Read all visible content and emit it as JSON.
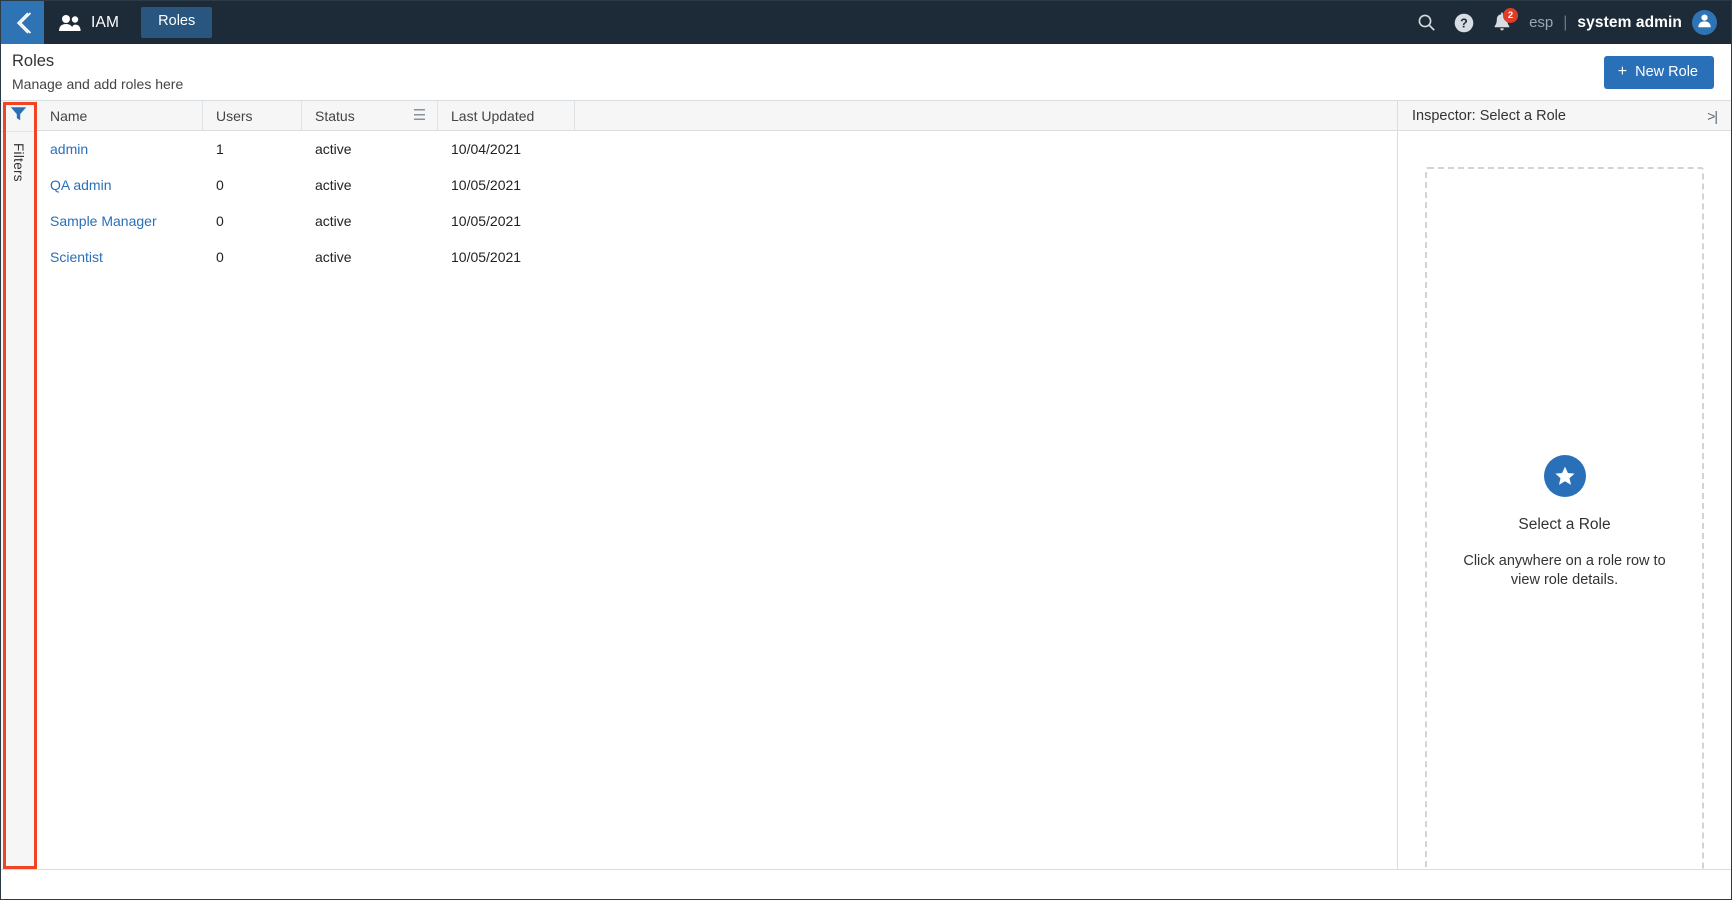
{
  "topnav": {
    "back_icon": "chevron-left-icon",
    "app_icon": "people-icon",
    "app_label": "IAM",
    "tab_label": "Roles",
    "search_icon": "search-icon",
    "help_icon": "help-circle-icon",
    "bell_icon": "bell-icon",
    "notification_count": "2",
    "language": "esp",
    "separator": "|",
    "user_name": "system admin",
    "avatar_icon": "user-avatar-icon",
    "accent_blue": "#2e74b5",
    "nav_background": "#1d2b38",
    "badge_color": "#e03c27"
  },
  "page": {
    "title": "Roles",
    "subtitle": "Manage and add roles here",
    "new_button_label": "New Role",
    "new_button_icon": "plus-icon",
    "new_button_color": "#2a70b8"
  },
  "filters": {
    "icon": "filter-funnel-icon",
    "label": "Filters",
    "highlight_color": "#f04423"
  },
  "table": {
    "columns": [
      {
        "key": "name",
        "label": "Name"
      },
      {
        "key": "users",
        "label": "Users"
      },
      {
        "key": "status",
        "label": "Status"
      },
      {
        "key": "menu",
        "label": "",
        "icon": "hamburger-menu-icon"
      },
      {
        "key": "date",
        "label": "Last Updated"
      }
    ],
    "rows": [
      {
        "name": "admin",
        "users": "1",
        "status": "active",
        "date": "10/04/2021"
      },
      {
        "name": "QA admin",
        "users": "0",
        "status": "active",
        "date": "10/05/2021"
      },
      {
        "name": "Sample Manager",
        "users": "0",
        "status": "active",
        "date": "10/05/2021"
      },
      {
        "name": "Scientist",
        "users": "0",
        "status": "active",
        "date": "10/05/2021"
      }
    ]
  },
  "inspector": {
    "title": "Inspector: Select a Role",
    "collapse_icon": "collapse-right-icon",
    "collapse_glyph": ">|",
    "empty_icon": "star-icon",
    "empty_title": "Select a Role",
    "empty_text": "Click anywhere on a role row to view role details."
  }
}
